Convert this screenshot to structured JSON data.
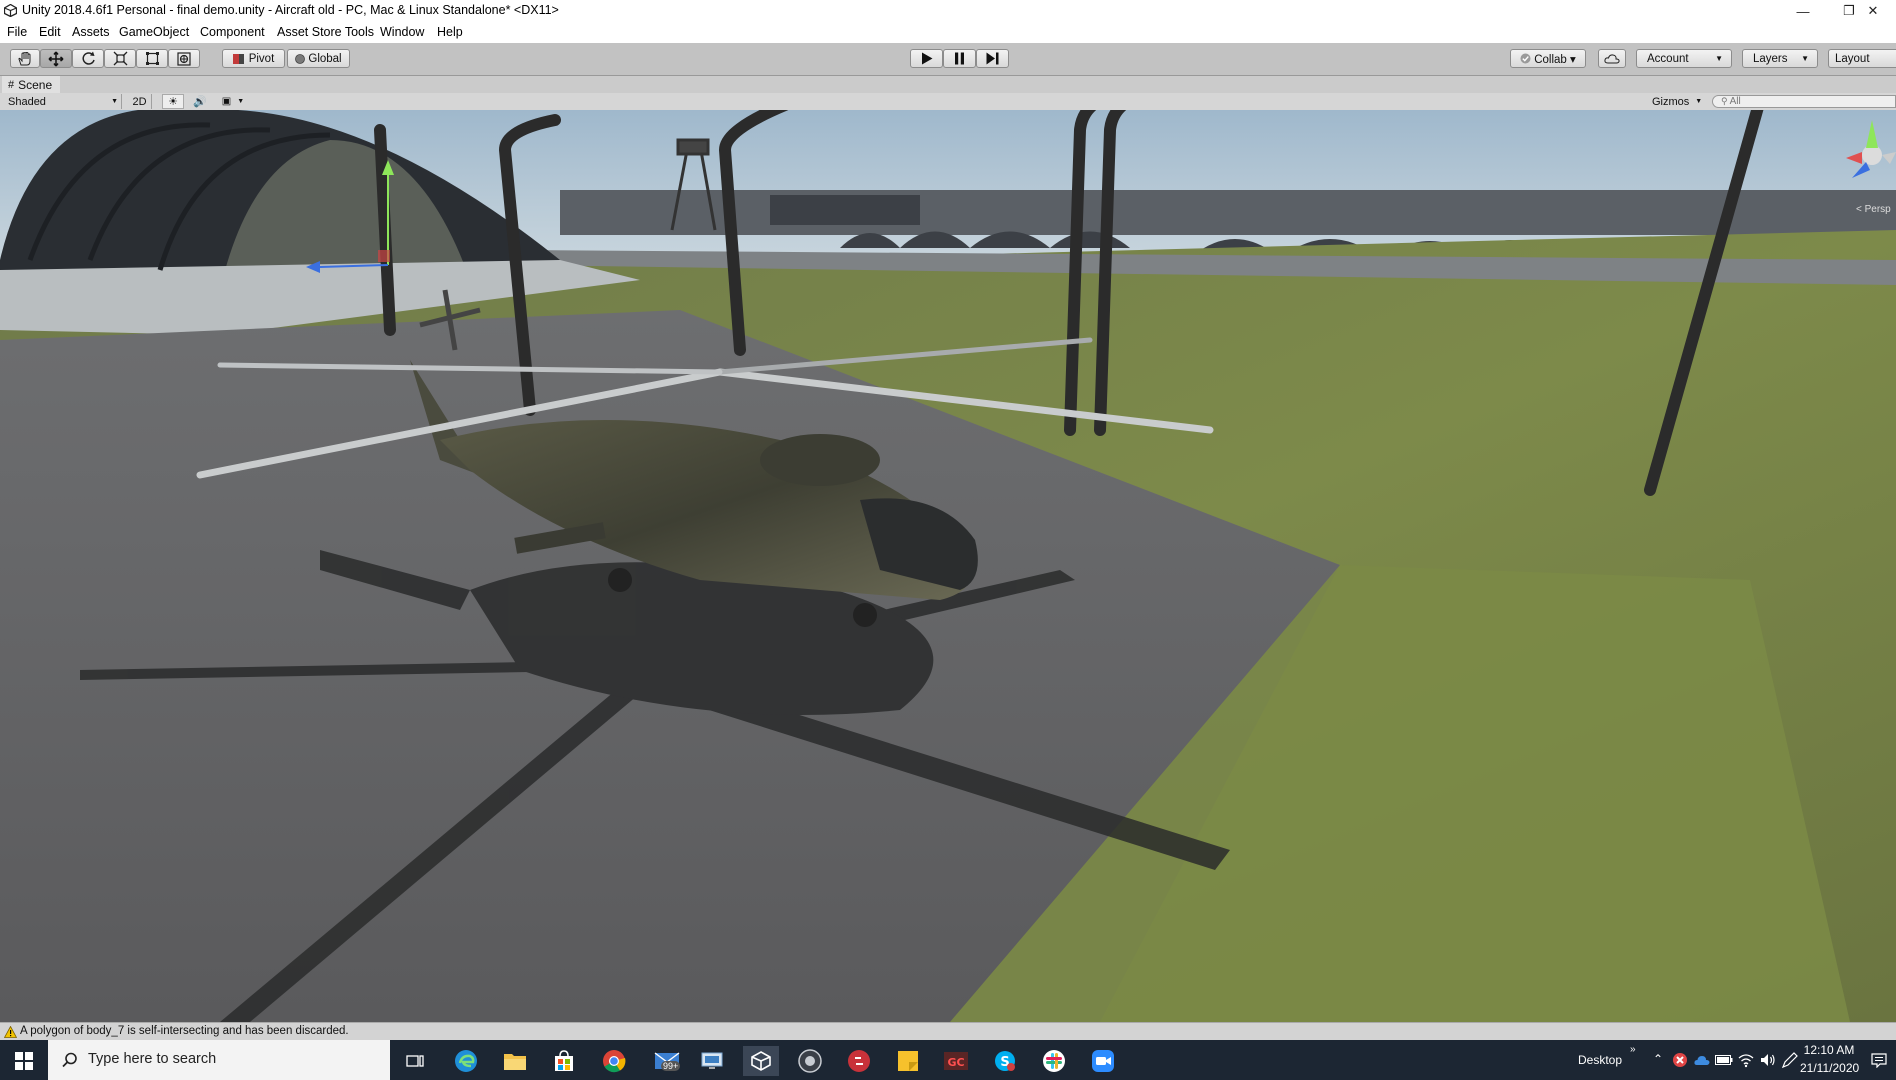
{
  "window": {
    "title": "Unity 2018.4.6f1 Personal - final demo.unity - Aircraft old - PC, Mac & Linux Standalone* <DX11>",
    "controls": {
      "minimize": "—",
      "maximize": "❐",
      "close": "✕"
    }
  },
  "menu": [
    "File",
    "Edit",
    "Assets",
    "GameObject",
    "Component",
    "Asset Store Tools",
    "Window",
    "Help"
  ],
  "toolbar": {
    "tools": [
      "hand-tool",
      "move-tool",
      "rotate-tool",
      "scale-tool",
      "rect-tool",
      "transform-tool"
    ],
    "active_tool": "move-tool",
    "pivot_label": "Pivot",
    "global_label": "Global",
    "play_controls": [
      "play",
      "pause",
      "step"
    ],
    "collab_label": "Collab ▾",
    "account_label": "Account",
    "layers_label": "Layers",
    "layout_label": "Layout"
  },
  "scene": {
    "tab_label": "Scene",
    "draw_mode": "Shaded",
    "mode_2d": "2D",
    "gizmos_label": "Gizmos",
    "search_placeholder": "All",
    "persp_label": "< Persp"
  },
  "status": {
    "message": "A polygon of body_7 is self-intersecting and has been discarded."
  },
  "taskbar": {
    "search_placeholder": "Type here to search",
    "badge": "99+",
    "desktop_label": "Desktop",
    "time": "12:10 AM",
    "date": "21/11/2020"
  }
}
